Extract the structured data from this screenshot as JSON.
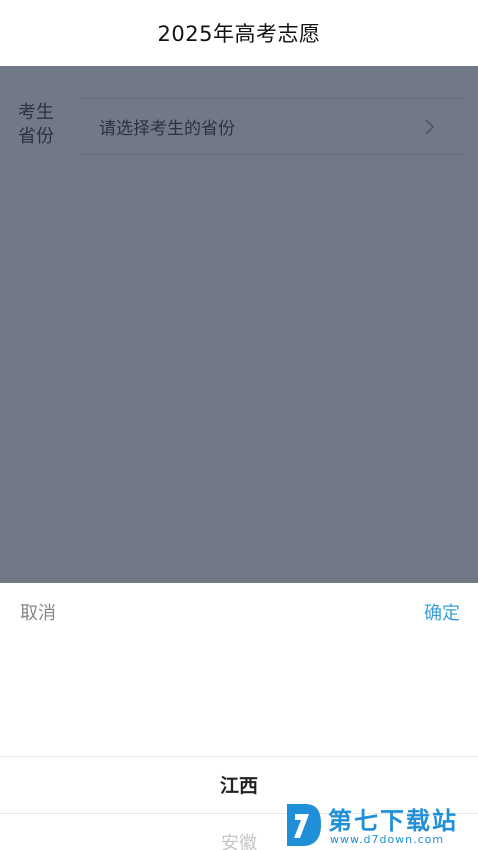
{
  "header": {
    "title": "2025年高考志愿"
  },
  "form": {
    "province_label": "考生省份",
    "province_placeholder": "请选择考生的省份"
  },
  "picker": {
    "cancel_label": "取消",
    "confirm_label": "确定",
    "selected_option": "江西",
    "next_option": "安徽"
  },
  "watermark": {
    "title": "第七下载站",
    "url": "www.d7down.com"
  },
  "colors": {
    "accent": "#3a9fd6",
    "overlay": "#263446",
    "watermark": "#1f8fd8"
  },
  "icons": {
    "field_chevron": "chevron-right-icon",
    "watermark_logo": "d7-logo-icon"
  }
}
